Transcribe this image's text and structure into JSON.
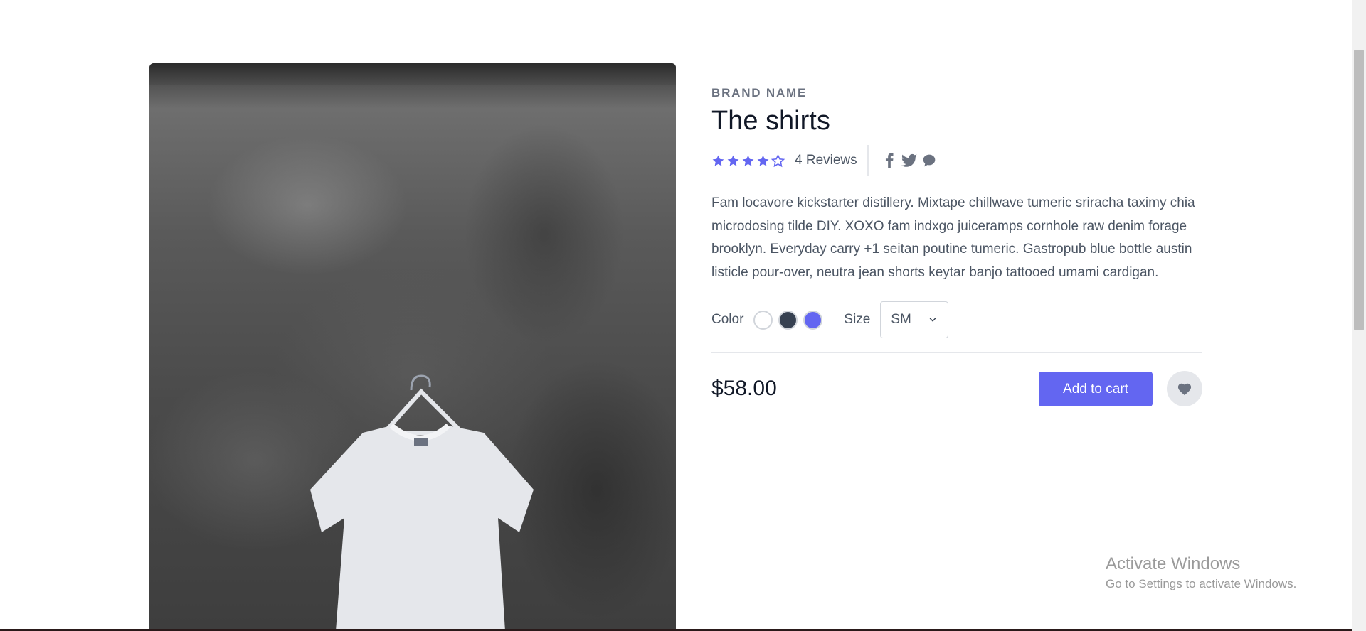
{
  "product": {
    "brand": "BRAND NAME",
    "title": "The shirts",
    "rating": 4,
    "rating_max": 5,
    "reviews": "4 Reviews",
    "description": "Fam locavore kickstarter distillery. Mixtape chillwave tumeric sriracha taximy chia microdosing tilde DIY. XOXO fam indxgo juiceramps cornhole raw denim forage brooklyn. Everyday carry +1 seitan poutine tumeric. Gastropub blue bottle austin listicle pour-over, neutra jean shorts keytar banjo tattooed umami cardigan.",
    "color_label": "Color",
    "colors": [
      "#ffffff",
      "#374151",
      "#6366f1"
    ],
    "size_label": "Size",
    "size_value": "SM",
    "price": "$58.00",
    "add_to_cart": "Add to cart"
  },
  "social_icons": [
    "facebook-icon",
    "twitter-icon",
    "chat-icon"
  ],
  "accent_color": "#6366f1",
  "watermark": {
    "title": "Activate Windows",
    "subtitle": "Go to Settings to activate Windows."
  }
}
